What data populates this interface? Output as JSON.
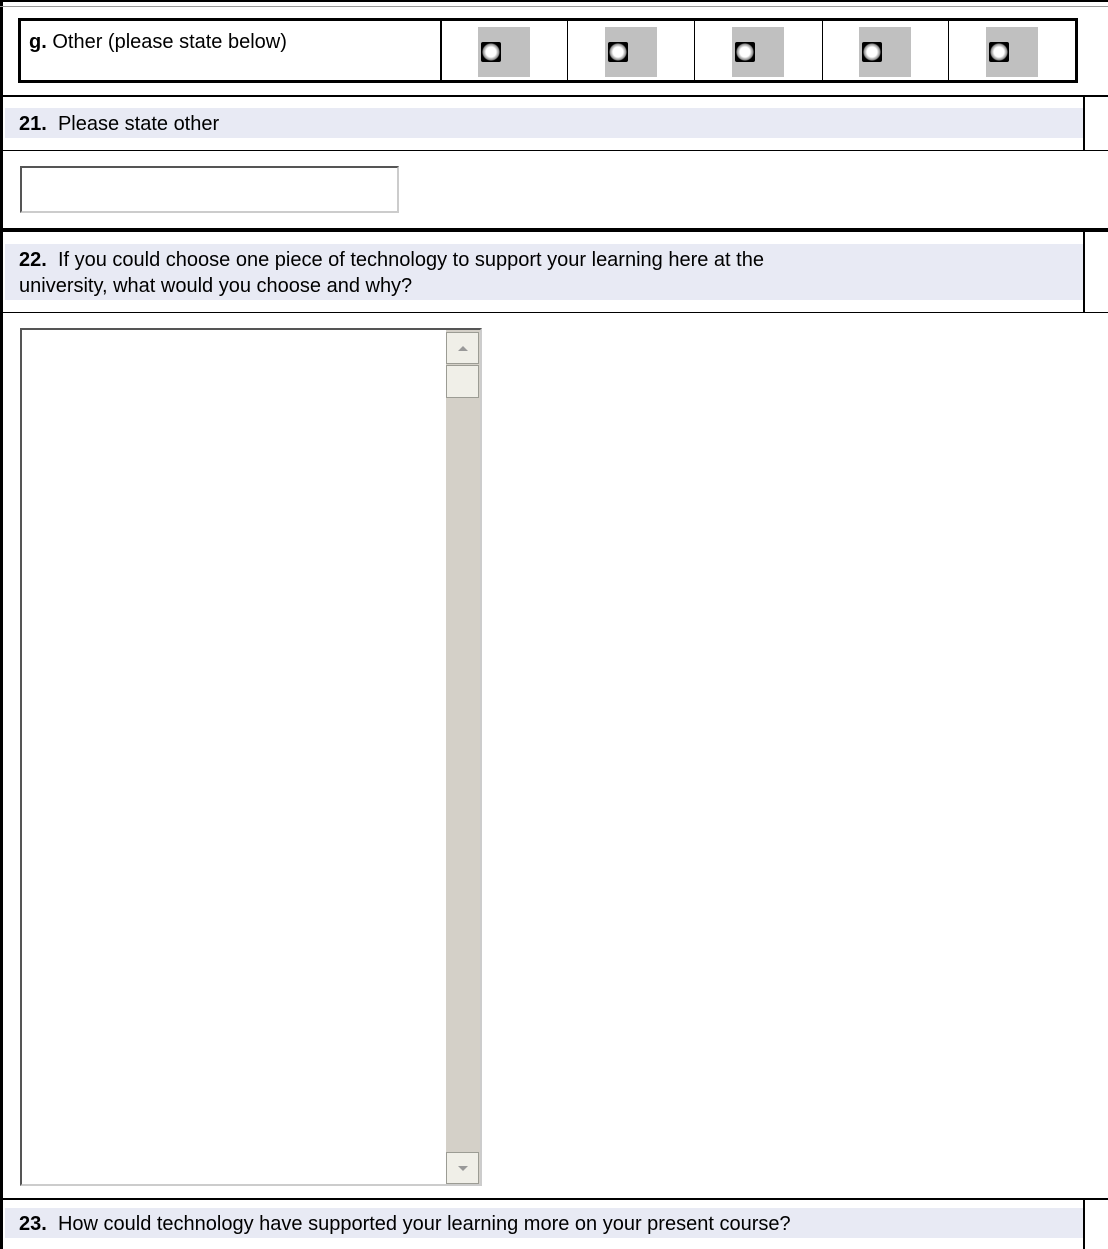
{
  "question_g": {
    "prefix": "g.",
    "label": "Other (please state below)",
    "radio_count": 5
  },
  "q21": {
    "number": "21.",
    "text": "Please state other",
    "input_value": ""
  },
  "q22": {
    "number": "22.",
    "line1": "If you could choose one piece of technology to support your learning here at the",
    "line2": "university, what would you choose and why?",
    "textarea_value": ""
  },
  "q23": {
    "number": "23.",
    "text": "How could technology have supported your learning more on your present course?"
  },
  "colors": {
    "question_bar": "#e8eaf4",
    "radio_cell": "#c0c0c0",
    "scrollbar_track": "#d4d0c8"
  }
}
